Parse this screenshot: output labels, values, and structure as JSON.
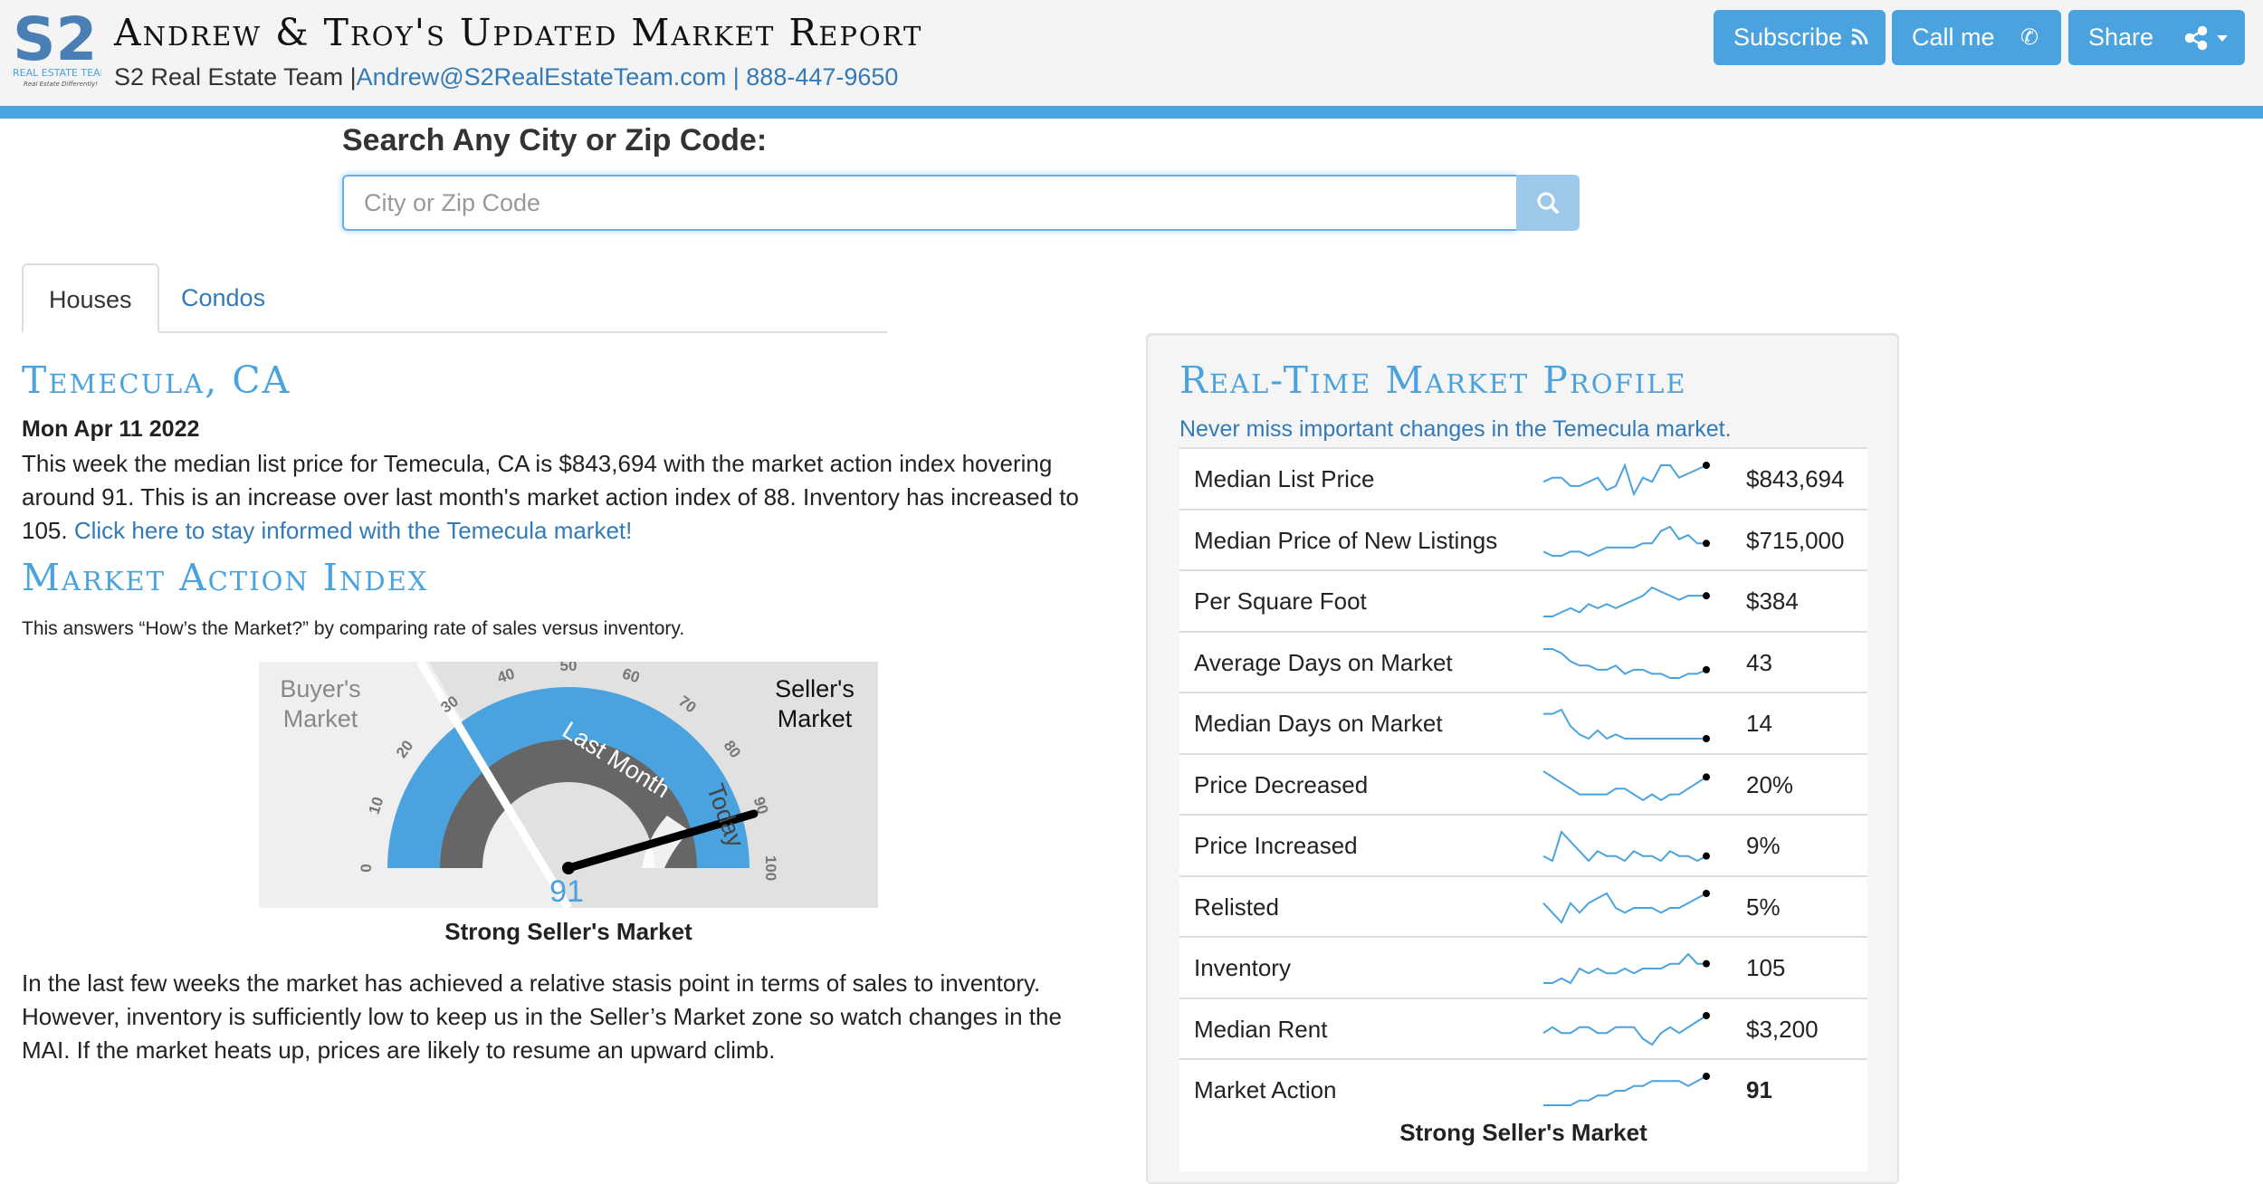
{
  "header": {
    "logo_text": "S2",
    "logo_subtext": "REAL ESTATE TEAM",
    "logo_tagline": "Real Estate Differently!",
    "title": "Andrew & Troy's Updated Market Report",
    "team": "S2 Real Estate Team |",
    "email": "Andrew@S2RealEstateTeam.com",
    "sep": " | ",
    "phone": "888-447-9650",
    "buttons": {
      "subscribe": "Subscribe",
      "call": "Call me",
      "share": "Share"
    },
    "accent": "#4aa3df"
  },
  "search": {
    "label": "Search Any City or Zip Code:",
    "placeholder": "City or Zip Code",
    "icon": "search-icon"
  },
  "tabs": [
    {
      "label": "Houses",
      "active": true
    },
    {
      "label": "Condos",
      "active": false
    }
  ],
  "city": {
    "title": "Temecula, CA",
    "date": "Mon Apr 11 2022",
    "summary": "This week the median list price for Temecula, CA is $843,694 with the market action index hovering around 91. This is an increase over last month's market action index of 88. Inventory has increased to 105. ",
    "summary_link": "Click here to stay informed with the Temecula market!"
  },
  "mai": {
    "title": "Market Action Index",
    "description": "This answers “How’s the Market?” by comparing rate of sales versus inventory.",
    "gauge": {
      "value": 91,
      "last_month": 88,
      "buyers_label": [
        "Buyer's",
        "Market"
      ],
      "sellers_label": [
        "Seller's",
        "Market"
      ],
      "ticks": [
        "0",
        "10",
        "20",
        "30",
        "40",
        "50",
        "60",
        "70",
        "80",
        "90",
        "100"
      ],
      "last_month_label": "Last Month",
      "today_label": "Today"
    },
    "caption": "Strong Seller's Market",
    "analysis": "In the last few weeks the market has achieved a relative stasis point in terms of sales to inventory. However, inventory is sufficiently low to keep us in the Seller’s Market zone so watch changes in the MAI. If the market heats up, prices are likely to resume an upward climb."
  },
  "profile": {
    "title": "Real-Time Market Profile",
    "subtitle": "Never miss important changes in the Temecula market.",
    "rows": [
      {
        "label": "Median List Price",
        "value": "$843,694",
        "spark": [
          5,
          6,
          6,
          4,
          4,
          5,
          6,
          3,
          4,
          9,
          2,
          6,
          5,
          9,
          9,
          6,
          7,
          8,
          9
        ]
      },
      {
        "label": "Median Price of New Listings",
        "value": "$715,000",
        "spark": [
          4,
          3,
          3,
          4,
          4,
          3,
          4,
          5,
          5,
          5,
          5,
          6,
          6,
          9,
          10,
          7,
          8,
          6,
          6
        ]
      },
      {
        "label": "Per Square Foot",
        "value": "$384",
        "spark": [
          3,
          3,
          4,
          5,
          4,
          6,
          5,
          6,
          5,
          6,
          7,
          8,
          10,
          9,
          8,
          7,
          8,
          8,
          8
        ]
      },
      {
        "label": "Average Days on Market",
        "value": "43",
        "spark": [
          9,
          9,
          8,
          6,
          5,
          5,
          4,
          4,
          5,
          3,
          4,
          4,
          3,
          3,
          2,
          2,
          3,
          3,
          4
        ]
      },
      {
        "label": "Median Days on Market",
        "value": "14",
        "spark": [
          8,
          8,
          9,
          5,
          3,
          2,
          4,
          2,
          3,
          2,
          2,
          2,
          2,
          2,
          2,
          2,
          2,
          2,
          2
        ]
      },
      {
        "label": "Price Decreased",
        "value": "20%",
        "spark": [
          8,
          7,
          6,
          5,
          4,
          4,
          4,
          4,
          5,
          5,
          4,
          3,
          4,
          3,
          4,
          4,
          5,
          6,
          7
        ]
      },
      {
        "label": "Price Increased",
        "value": "9%",
        "spark": [
          3,
          2,
          8,
          6,
          4,
          2,
          4,
          3,
          3,
          2,
          4,
          3,
          3,
          2,
          4,
          3,
          3,
          2,
          3
        ]
      },
      {
        "label": "Relisted",
        "value": "5%",
        "spark": [
          5,
          3,
          1,
          5,
          3,
          5,
          6,
          7,
          4,
          3,
          4,
          4,
          4,
          3,
          4,
          4,
          5,
          6,
          7
        ]
      },
      {
        "label": "Inventory",
        "value": "105",
        "spark": [
          2,
          2,
          3,
          2,
          5,
          4,
          5,
          4,
          4,
          5,
          4,
          5,
          5,
          5,
          6,
          6,
          8,
          6,
          6
        ]
      },
      {
        "label": "Median Rent",
        "value": "$3,200",
        "spark": [
          5,
          6,
          5,
          5,
          6,
          6,
          5,
          5,
          6,
          6,
          6,
          4,
          3,
          5,
          6,
          5,
          6,
          7,
          8
        ]
      },
      {
        "label": "Market Action",
        "value": "91",
        "bold": true,
        "spark": [
          2,
          2,
          2,
          2,
          3,
          3,
          4,
          4,
          5,
          5,
          6,
          6,
          7,
          7,
          7,
          7,
          6,
          7,
          8
        ]
      }
    ],
    "caption": "Strong Seller's Market"
  }
}
